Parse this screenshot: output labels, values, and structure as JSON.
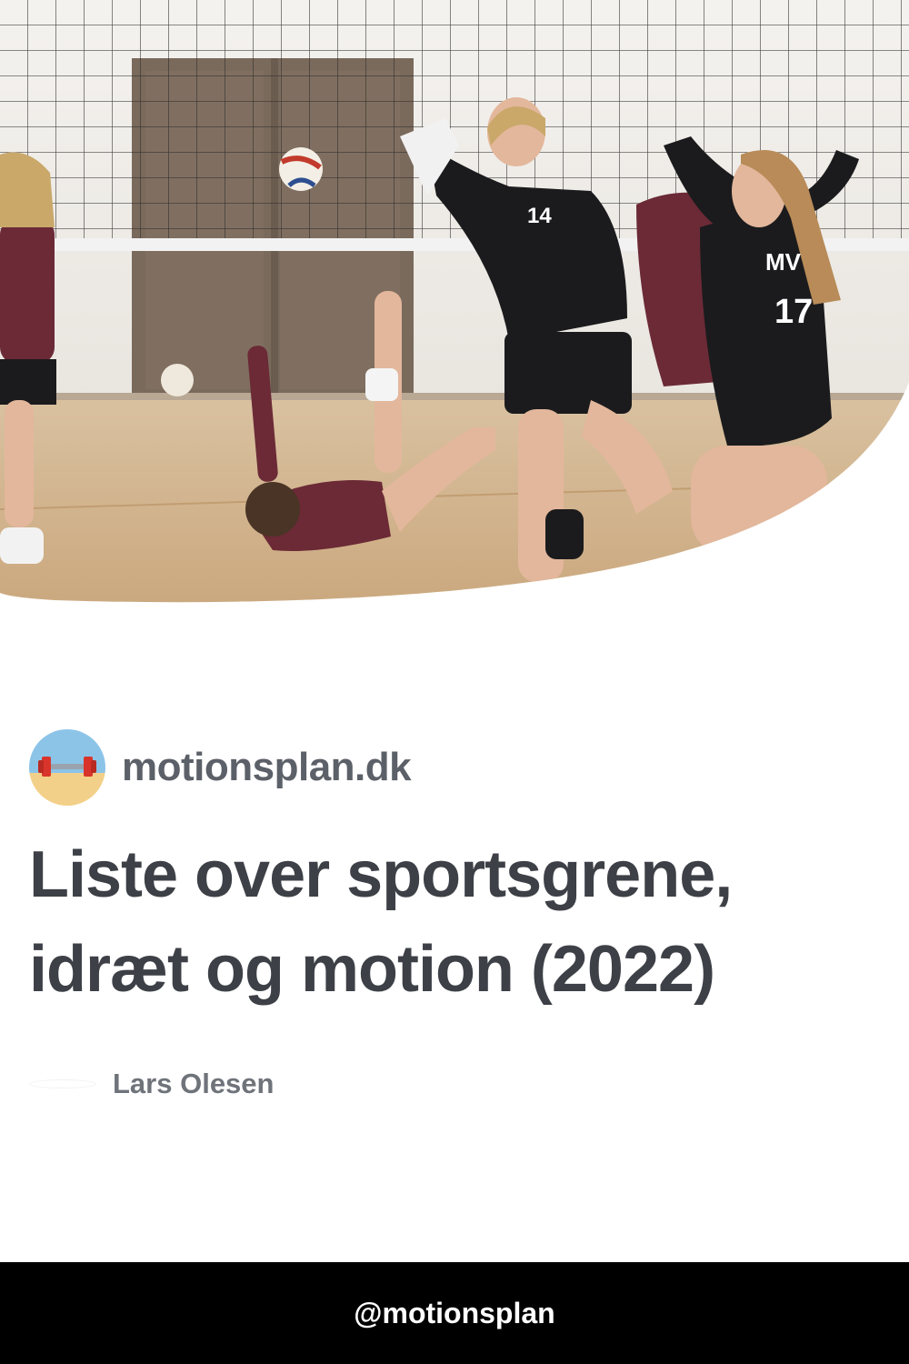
{
  "hero": {
    "image_icon": "volleyball-team-celebration-photo",
    "jersey_numbers": [
      "14",
      "17"
    ],
    "jersey_text": "MV"
  },
  "site": {
    "logo_icon": "dumbbell-beach-icon",
    "name": "motionsplan.dk"
  },
  "article": {
    "title": "Liste over sportsgrene, idræt og motion (2022)",
    "author": "Lars Olesen"
  },
  "footer": {
    "handle": "@motionsplan"
  },
  "colors": {
    "title_text": "#3d4046",
    "site_text": "#5c6068",
    "author_text": "#6f737a",
    "footer_bg": "#000000",
    "footer_text": "#ffffff",
    "jersey_black": "#1b1b1d",
    "jersey_maroon": "#6b2a36",
    "floor_wood": "#d7b990"
  }
}
